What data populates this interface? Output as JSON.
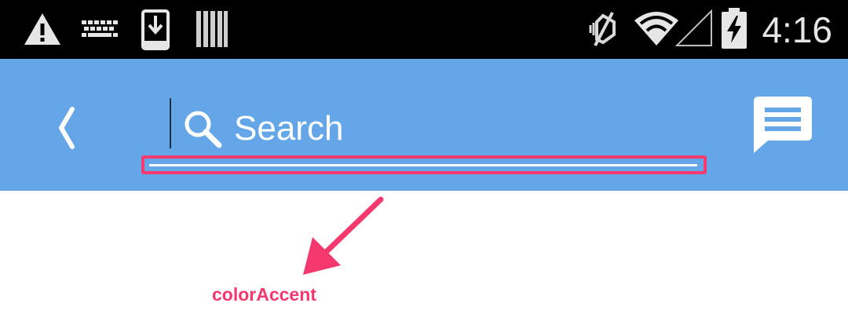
{
  "status_bar": {
    "time": "4:16",
    "icons_left": [
      "warning-icon",
      "keyboard-icon",
      "download-icon",
      "barcode-icon"
    ],
    "icons_right": [
      "vibrate-off-icon",
      "wifi-icon",
      "signal-icon",
      "battery-charging-icon"
    ]
  },
  "toolbar": {
    "background": "#64a6e8",
    "search_placeholder": "Search",
    "back_icon": "chevron-left-icon",
    "search_icon": "magnifier-icon",
    "message_icon": "message-icon"
  },
  "annotation": {
    "label": "colorAccent",
    "color": "#f5396e"
  }
}
